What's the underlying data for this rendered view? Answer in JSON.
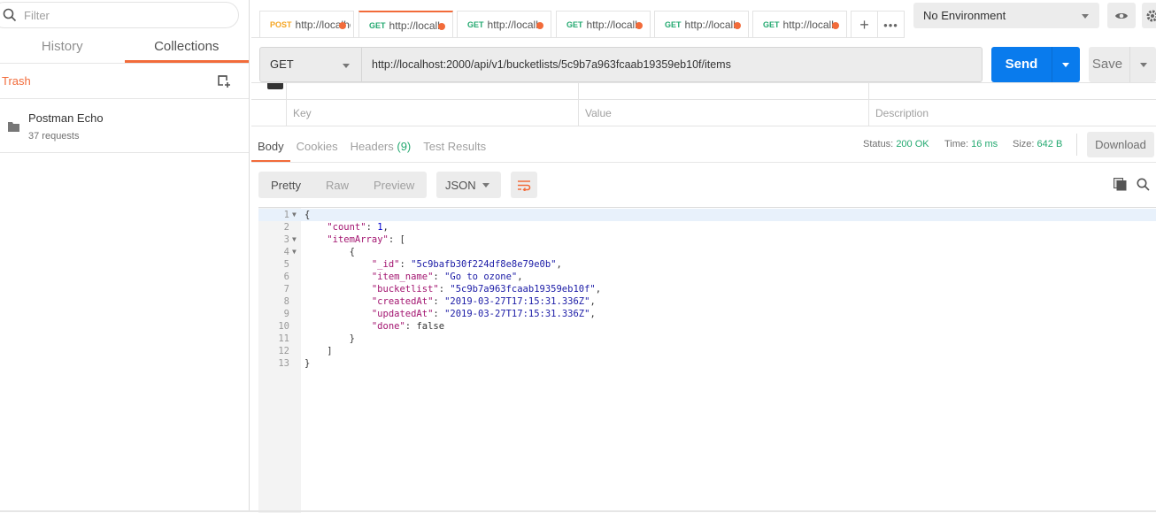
{
  "sidebar": {
    "filter_placeholder": "Filter",
    "tabs": [
      {
        "label": "History"
      },
      {
        "label": "Collections",
        "active": true
      }
    ],
    "trash_label": "Trash",
    "collections": [
      {
        "name": "Postman Echo",
        "count": "37 requests"
      }
    ]
  },
  "tabs": [
    {
      "method": "POST",
      "url": "http://localhost",
      "color": "#f5a623"
    },
    {
      "method": "GET",
      "url": "http://localhost",
      "color": "#23a970",
      "active": true
    },
    {
      "method": "GET",
      "url": "http://localhost",
      "color": "#23a970"
    },
    {
      "method": "GET",
      "url": "http://localhost",
      "color": "#23a970"
    },
    {
      "method": "GET",
      "url": "http://localhost",
      "color": "#23a970"
    },
    {
      "method": "GET",
      "url": "http://localhost",
      "color": "#23a970"
    }
  ],
  "environment": {
    "selected": "No Environment"
  },
  "request": {
    "method": "GET",
    "url": "http://localhost:2000/api/v1/bucketlists/5c9b7a963fcaab19359eb10f/items",
    "send_label": "Send",
    "save_label": "Save"
  },
  "params": {
    "key_placeholder": "Key",
    "value_placeholder": "Value",
    "description_placeholder": "Description"
  },
  "response": {
    "tabs": [
      {
        "label": "Body",
        "active": true
      },
      {
        "label": "Cookies"
      },
      {
        "label": "Headers",
        "badge": "(9)"
      },
      {
        "label": "Test Results"
      }
    ],
    "status_label": "Status:",
    "status": "200 OK",
    "time_label": "Time:",
    "time": "16 ms",
    "size_label": "Size:",
    "size": "642 B",
    "download_label": "Download",
    "views": [
      "Pretty",
      "Raw",
      "Preview"
    ],
    "format": "JSON",
    "body_lines": [
      {
        "n": "1",
        "fold": true,
        "indent": 0,
        "tokens": [
          [
            "p",
            "{"
          ]
        ]
      },
      {
        "n": "2",
        "indent": 1,
        "tokens": [
          [
            "k",
            "\"count\""
          ],
          [
            "p",
            ": "
          ],
          [
            "n",
            "1"
          ],
          [
            "p",
            ","
          ]
        ]
      },
      {
        "n": "3",
        "fold": true,
        "indent": 1,
        "tokens": [
          [
            "k",
            "\"itemArray\""
          ],
          [
            "p",
            ": ["
          ]
        ]
      },
      {
        "n": "4",
        "fold": true,
        "indent": 2,
        "tokens": [
          [
            "p",
            "{"
          ]
        ]
      },
      {
        "n": "5",
        "indent": 3,
        "tokens": [
          [
            "k",
            "\"_id\""
          ],
          [
            "p",
            ": "
          ],
          [
            "s",
            "\"5c9bafb30f224df8e8e79e0b\""
          ],
          [
            "p",
            ","
          ]
        ]
      },
      {
        "n": "6",
        "indent": 3,
        "tokens": [
          [
            "k",
            "\"item_name\""
          ],
          [
            "p",
            ": "
          ],
          [
            "s",
            "\"Go to ozone\""
          ],
          [
            "p",
            ","
          ]
        ]
      },
      {
        "n": "7",
        "indent": 3,
        "tokens": [
          [
            "k",
            "\"bucketlist\""
          ],
          [
            "p",
            ": "
          ],
          [
            "s",
            "\"5c9b7a963fcaab19359eb10f\""
          ],
          [
            "p",
            ","
          ]
        ]
      },
      {
        "n": "8",
        "indent": 3,
        "tokens": [
          [
            "k",
            "\"createdAt\""
          ],
          [
            "p",
            ": "
          ],
          [
            "s",
            "\"2019-03-27T17:15:31.336Z\""
          ],
          [
            "p",
            ","
          ]
        ]
      },
      {
        "n": "9",
        "indent": 3,
        "tokens": [
          [
            "k",
            "\"updatedAt\""
          ],
          [
            "p",
            ": "
          ],
          [
            "s",
            "\"2019-03-27T17:15:31.336Z\""
          ],
          [
            "p",
            ","
          ]
        ]
      },
      {
        "n": "10",
        "indent": 3,
        "tokens": [
          [
            "k",
            "\"done\""
          ],
          [
            "p",
            ": false"
          ]
        ]
      },
      {
        "n": "11",
        "indent": 2,
        "tokens": [
          [
            "p",
            "}"
          ]
        ]
      },
      {
        "n": "12",
        "indent": 1,
        "tokens": [
          [
            "p",
            "]"
          ]
        ]
      },
      {
        "n": "13",
        "indent": 0,
        "tokens": [
          [
            "p",
            "}"
          ]
        ]
      }
    ]
  },
  "colors": {
    "accent": "#f26b3a",
    "primary": "#097bed",
    "success": "#23a970"
  }
}
